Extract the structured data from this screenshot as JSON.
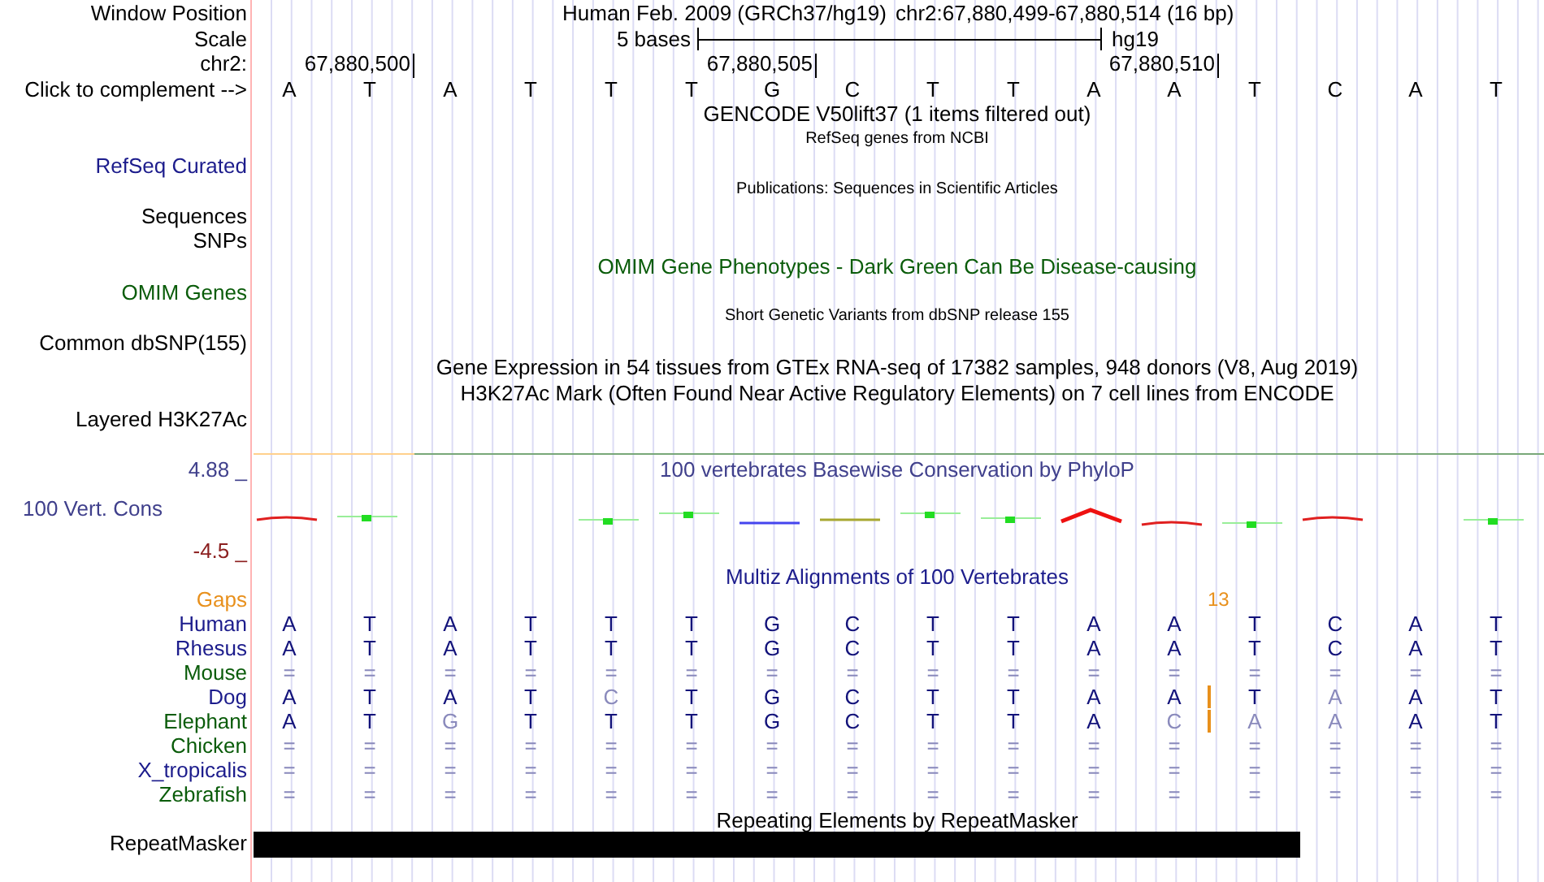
{
  "header": {
    "label": "Window Position",
    "assembly": "Human Feb. 2009 (GRCh37/hg19)",
    "position": "chr2:67,880,499-67,880,514 (16 bp)"
  },
  "scale": {
    "label": "Scale",
    "length": "5 bases",
    "assembly": "hg19"
  },
  "ruler": {
    "label": "chr2:",
    "ticks": [
      "67,880,500",
      "67,880,505",
      "67,880,510"
    ]
  },
  "sequence": {
    "label": "Click to complement -->",
    "bases": [
      "A",
      "T",
      "A",
      "T",
      "T",
      "T",
      "G",
      "C",
      "T",
      "T",
      "A",
      "A",
      "T",
      "C",
      "A",
      "T"
    ]
  },
  "tracks": [
    {
      "kind": "title",
      "text": "GENCODE V50lift37 (1 items filtered out)",
      "color": "#000000",
      "small": false
    },
    {
      "kind": "title",
      "text": "RefSeq genes from NCBI",
      "color": "#000000",
      "small": true
    },
    {
      "kind": "label",
      "text": "RefSeq Curated",
      "color": "#1c1c8c"
    },
    {
      "kind": "title",
      "text": "Publications: Sequences in Scientific Articles",
      "color": "#000000",
      "small": true
    },
    {
      "kind": "label",
      "text": "Sequences",
      "color": "#000000"
    },
    {
      "kind": "label",
      "text": "SNPs",
      "color": "#000000"
    },
    {
      "kind": "title",
      "text": "OMIM Gene Phenotypes - Dark Green Can Be Disease-causing",
      "color": "#0a5c0a",
      "small": false
    },
    {
      "kind": "label",
      "text": "OMIM Genes",
      "color": "#0a5c0a"
    },
    {
      "kind": "title",
      "text": "Short Genetic Variants from dbSNP release 155",
      "color": "#000000",
      "small": true
    },
    {
      "kind": "label",
      "text": "Common dbSNP(155)",
      "color": "#000000"
    },
    {
      "kind": "title",
      "text": "Gene Expression in 54 tissues from GTEx RNA-seq of 17382 samples, 948 donors (V8, Aug 2019)",
      "color": "#000000",
      "small": false
    },
    {
      "kind": "title",
      "text": "H3K27Ac Mark (Often Found Near Active Regulatory Elements) on 7 cell lines from ENCODE",
      "color": "#000000",
      "small": false
    },
    {
      "kind": "label",
      "text": "Layered H3K27Ac",
      "color": "#000000"
    }
  ],
  "conservation": {
    "title": "100 vertebrates Basewise Conservation by PhyloP",
    "label": "100 Vert. Cons",
    "max": "4.88 _",
    "min": "-4.5 _"
  },
  "alignment": {
    "title": "Multiz Alignments of 100 Vertebrates",
    "gaps_label": "Gaps",
    "gap_count": "13",
    "species": [
      {
        "name": "Human",
        "color": "#1c1c8c",
        "bases": [
          {
            "b": "A",
            "faded": false
          },
          {
            "b": "T",
            "faded": false
          },
          {
            "b": "A",
            "faded": false
          },
          {
            "b": "T",
            "faded": false
          },
          {
            "b": "T",
            "faded": false
          },
          {
            "b": "T",
            "faded": false
          },
          {
            "b": "G",
            "faded": false
          },
          {
            "b": "C",
            "faded": false
          },
          {
            "b": "T",
            "faded": false
          },
          {
            "b": "T",
            "faded": false
          },
          {
            "b": "A",
            "faded": false
          },
          {
            "b": "A",
            "faded": false
          },
          {
            "b": "T",
            "faded": false
          },
          {
            "b": "C",
            "faded": false
          },
          {
            "b": "A",
            "faded": false
          },
          {
            "b": "T",
            "faded": false
          }
        ]
      },
      {
        "name": "Rhesus",
        "color": "#1c1c8c",
        "bases": [
          {
            "b": "A",
            "faded": false
          },
          {
            "b": "T",
            "faded": false
          },
          {
            "b": "A",
            "faded": false
          },
          {
            "b": "T",
            "faded": false
          },
          {
            "b": "T",
            "faded": false
          },
          {
            "b": "T",
            "faded": false
          },
          {
            "b": "G",
            "faded": false
          },
          {
            "b": "C",
            "faded": false
          },
          {
            "b": "T",
            "faded": false
          },
          {
            "b": "T",
            "faded": false
          },
          {
            "b": "A",
            "faded": false
          },
          {
            "b": "A",
            "faded": false
          },
          {
            "b": "T",
            "faded": false
          },
          {
            "b": "C",
            "faded": false
          },
          {
            "b": "A",
            "faded": false
          },
          {
            "b": "T",
            "faded": false
          }
        ]
      },
      {
        "name": "Mouse",
        "color": "#0a5c0a",
        "bases": [
          {
            "b": "=",
            "faded": true
          },
          {
            "b": "=",
            "faded": true
          },
          {
            "b": "=",
            "faded": true
          },
          {
            "b": "=",
            "faded": true
          },
          {
            "b": "=",
            "faded": true
          },
          {
            "b": "=",
            "faded": true
          },
          {
            "b": "=",
            "faded": true
          },
          {
            "b": "=",
            "faded": true
          },
          {
            "b": "=",
            "faded": true
          },
          {
            "b": "=",
            "faded": true
          },
          {
            "b": "=",
            "faded": true
          },
          {
            "b": "=",
            "faded": true
          },
          {
            "b": "=",
            "faded": true
          },
          {
            "b": "=",
            "faded": true
          },
          {
            "b": "=",
            "faded": true
          },
          {
            "b": "=",
            "faded": true
          }
        ]
      },
      {
        "name": "Dog",
        "color": "#1c1c8c",
        "bases": [
          {
            "b": "A",
            "faded": false
          },
          {
            "b": "T",
            "faded": false
          },
          {
            "b": "A",
            "faded": false
          },
          {
            "b": "T",
            "faded": false
          },
          {
            "b": "C",
            "faded": true
          },
          {
            "b": "T",
            "faded": false
          },
          {
            "b": "G",
            "faded": false
          },
          {
            "b": "C",
            "faded": false
          },
          {
            "b": "T",
            "faded": false
          },
          {
            "b": "T",
            "faded": false
          },
          {
            "b": "A",
            "faded": false
          },
          {
            "b": "A",
            "faded": false,
            "insert_after": true
          },
          {
            "b": "T",
            "faded": false
          },
          {
            "b": "A",
            "faded": true
          },
          {
            "b": "A",
            "faded": false
          },
          {
            "b": "T",
            "faded": false
          }
        ]
      },
      {
        "name": "Elephant",
        "color": "#0a5c0a",
        "bases": [
          {
            "b": "A",
            "faded": false
          },
          {
            "b": "T",
            "faded": false
          },
          {
            "b": "G",
            "faded": true
          },
          {
            "b": "T",
            "faded": false
          },
          {
            "b": "T",
            "faded": false
          },
          {
            "b": "T",
            "faded": false
          },
          {
            "b": "G",
            "faded": false
          },
          {
            "b": "C",
            "faded": false
          },
          {
            "b": "T",
            "faded": false
          },
          {
            "b": "T",
            "faded": false
          },
          {
            "b": "A",
            "faded": false
          },
          {
            "b": "C",
            "faded": true,
            "insert_after": true
          },
          {
            "b": "A",
            "faded": true
          },
          {
            "b": "A",
            "faded": true
          },
          {
            "b": "A",
            "faded": false
          },
          {
            "b": "T",
            "faded": false
          }
        ]
      },
      {
        "name": "Chicken",
        "color": "#0a5c0a",
        "bases": [
          {
            "b": "=",
            "faded": true
          },
          {
            "b": "=",
            "faded": true
          },
          {
            "b": "=",
            "faded": true
          },
          {
            "b": "=",
            "faded": true
          },
          {
            "b": "=",
            "faded": true
          },
          {
            "b": "=",
            "faded": true
          },
          {
            "b": "=",
            "faded": true
          },
          {
            "b": "=",
            "faded": true
          },
          {
            "b": "=",
            "faded": true
          },
          {
            "b": "=",
            "faded": true
          },
          {
            "b": "=",
            "faded": true
          },
          {
            "b": "=",
            "faded": true
          },
          {
            "b": "=",
            "faded": true
          },
          {
            "b": "=",
            "faded": true
          },
          {
            "b": "=",
            "faded": true
          },
          {
            "b": "=",
            "faded": true
          }
        ]
      },
      {
        "name": "X_tropicalis",
        "color": "#1c1c8c",
        "bases": [
          {
            "b": "=",
            "faded": true
          },
          {
            "b": "=",
            "faded": true
          },
          {
            "b": "=",
            "faded": true
          },
          {
            "b": "=",
            "faded": true
          },
          {
            "b": "=",
            "faded": true
          },
          {
            "b": "=",
            "faded": true
          },
          {
            "b": "=",
            "faded": true
          },
          {
            "b": "=",
            "faded": true
          },
          {
            "b": "=",
            "faded": true
          },
          {
            "b": "=",
            "faded": true
          },
          {
            "b": "=",
            "faded": true
          },
          {
            "b": "=",
            "faded": true
          },
          {
            "b": "=",
            "faded": true
          },
          {
            "b": "=",
            "faded": true
          },
          {
            "b": "=",
            "faded": true
          },
          {
            "b": "=",
            "faded": true
          }
        ]
      },
      {
        "name": "Zebrafish",
        "color": "#0a5c0a",
        "bases": [
          {
            "b": "=",
            "faded": true
          },
          {
            "b": "=",
            "faded": true
          },
          {
            "b": "=",
            "faded": true
          },
          {
            "b": "=",
            "faded": true
          },
          {
            "b": "=",
            "faded": true
          },
          {
            "b": "=",
            "faded": true
          },
          {
            "b": "=",
            "faded": true
          },
          {
            "b": "=",
            "faded": true
          },
          {
            "b": "=",
            "faded": true
          },
          {
            "b": "=",
            "faded": true
          },
          {
            "b": "=",
            "faded": true
          },
          {
            "b": "=",
            "faded": true
          },
          {
            "b": "=",
            "faded": true
          },
          {
            "b": "=",
            "faded": true
          },
          {
            "b": "=",
            "faded": true
          },
          {
            "b": "=",
            "faded": true
          }
        ]
      }
    ]
  },
  "repeats": {
    "title": "Repeating Elements by RepeatMasker",
    "label": "RepeatMasker"
  }
}
